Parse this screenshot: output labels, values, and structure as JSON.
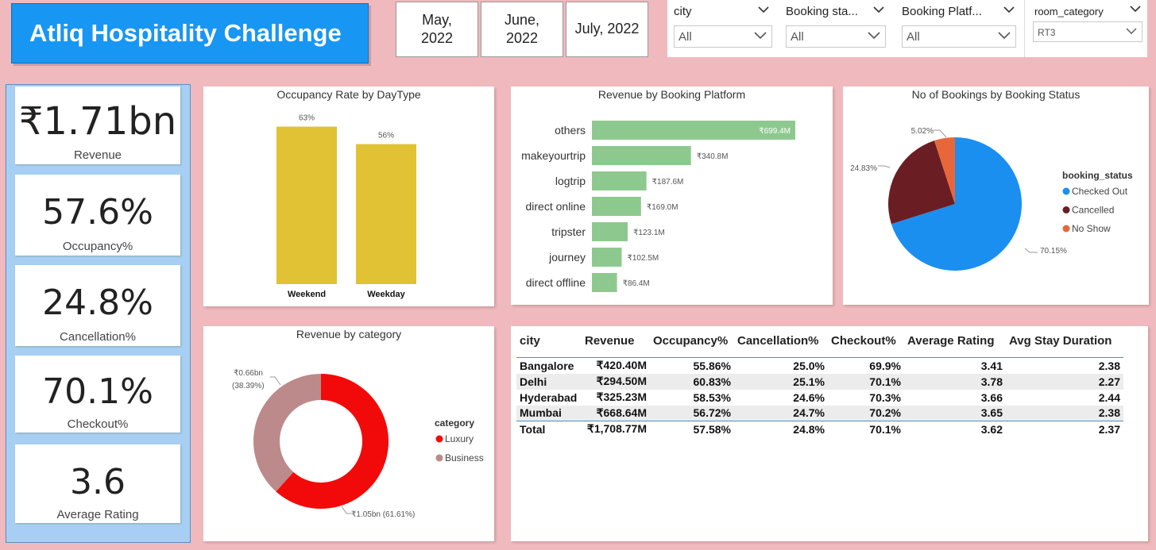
{
  "header": {
    "title": "Atliq Hospitality Challenge",
    "months": [
      {
        "line1": "May,",
        "line2": "2022"
      },
      {
        "line1": "June,",
        "line2": "2022"
      },
      {
        "line1": "July, 2022",
        "line2": ""
      }
    ]
  },
  "slicers": [
    {
      "label": "city",
      "value": "All"
    },
    {
      "label": "Booking sta...",
      "value": "All"
    },
    {
      "label": "Booking Platf...",
      "value": "All"
    },
    {
      "label": "room_category",
      "value": "RT3"
    }
  ],
  "kpis": [
    {
      "value": "₹1.71bn",
      "label": "Revenue"
    },
    {
      "value": "57.6%",
      "label": "Occupancy%"
    },
    {
      "value": "24.8%",
      "label": "Cancellation%"
    },
    {
      "value": "70.1%",
      "label": "Checkout%"
    },
    {
      "value": "3.6",
      "label": "Average Rating"
    }
  ],
  "colors": {
    "accent": "#1896f3",
    "bar_yellow": "#e0c234",
    "bar_green": "#8dc98e",
    "checked_out": "#1a8ff0",
    "cancelled": "#6a1e24",
    "no_show": "#e8673a",
    "luxury": "#f20a0a",
    "business": "#bc8a8a"
  },
  "chart_data": [
    {
      "type": "bar",
      "title": "Occupancy Rate by DayType",
      "categories": [
        "Weekend",
        "Weekday"
      ],
      "values": [
        63,
        56
      ],
      "labels": [
        "63%",
        "56%"
      ]
    },
    {
      "type": "bar",
      "title": "Revenue by Booking Platform",
      "categories": [
        "others",
        "makeyourtrip",
        "logtrip",
        "direct online",
        "tripster",
        "journey",
        "direct offline"
      ],
      "values": [
        699.4,
        340.8,
        187.6,
        169.0,
        123.1,
        102.5,
        86.4
      ],
      "labels": [
        "₹699.4M",
        "₹340.8M",
        "₹187.6M",
        "₹169.0M",
        "₹123.1M",
        "₹102.5M",
        "₹86.4M"
      ]
    },
    {
      "type": "pie",
      "title": "No of Bookings by Booking Status",
      "legend_title": "booking_status",
      "categories": [
        "Checked Out",
        "Cancelled",
        "No Show"
      ],
      "values": [
        70.15,
        24.83,
        5.02
      ],
      "labels": [
        "70.15%",
        "24.83%",
        "5.02%"
      ],
      "legend": "right"
    },
    {
      "type": "pie",
      "title": "Revenue by category",
      "legend_title": "category",
      "categories": [
        "Luxury",
        "Business"
      ],
      "values": [
        61.61,
        38.39
      ],
      "labels": [
        "₹1.05bn (61.61%)",
        "₹0.66bn (38.39%)"
      ],
      "legend": "right"
    }
  ],
  "table": {
    "columns": [
      "city",
      "Revenue",
      "Occupancy%",
      "Cancellation%",
      "Checkout%",
      "Average Rating",
      "Avg Stay Duration"
    ],
    "rows": [
      [
        "Bangalore",
        "₹420.40M",
        "55.86%",
        "25.0%",
        "69.9%",
        "3.41",
        "2.38"
      ],
      [
        "Delhi",
        "₹294.50M",
        "60.83%",
        "25.1%",
        "70.1%",
        "3.78",
        "2.27"
      ],
      [
        "Hyderabad",
        "₹325.23M",
        "58.53%",
        "24.6%",
        "70.3%",
        "3.66",
        "2.44"
      ],
      [
        "Mumbai",
        "₹668.64M",
        "56.72%",
        "24.7%",
        "70.2%",
        "3.65",
        "2.38"
      ]
    ],
    "total": [
      "Total",
      "₹1,708.77M",
      "57.58%",
      "24.8%",
      "70.1%",
      "3.62",
      "2.37"
    ]
  }
}
